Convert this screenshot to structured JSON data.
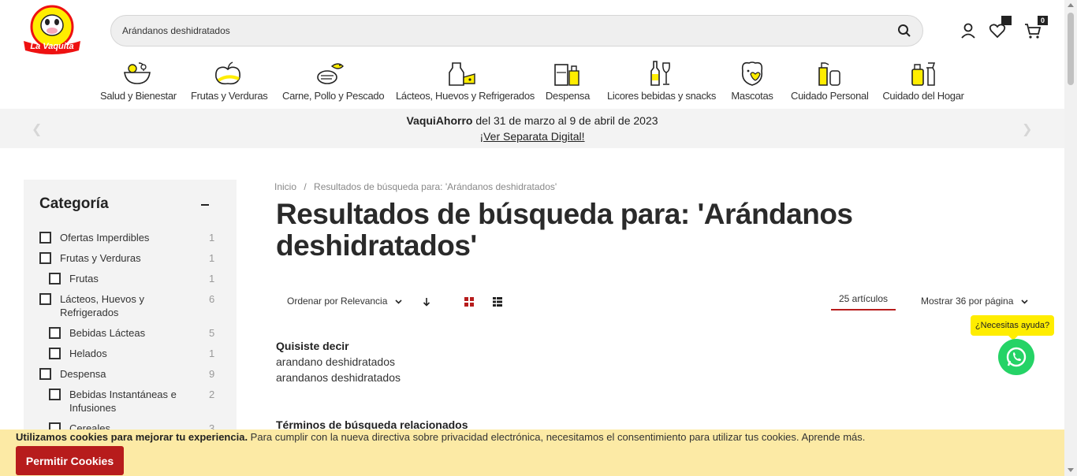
{
  "brand": {
    "logo_text": "La Vaquita"
  },
  "search": {
    "value": "Arándanos deshidratados",
    "placeholder": ""
  },
  "header": {
    "wishlist_badge": "",
    "cart_badge": "0"
  },
  "categories": [
    {
      "label": "Salud y Bienestar",
      "icon": "salad-bowl-icon"
    },
    {
      "label": "Frutas y Verduras",
      "icon": "fruits-icon"
    },
    {
      "label": "Carne, Pollo y Pescado",
      "icon": "meat-fish-icon"
    },
    {
      "label": "Lácteos, Huevos y Refrigerados",
      "icon": "dairy-icon"
    },
    {
      "label": "Despensa",
      "icon": "pantry-icon"
    },
    {
      "label": "Licores bebidas y snacks",
      "icon": "drinks-icon"
    },
    {
      "label": "Mascotas",
      "icon": "pet-icon"
    },
    {
      "label": "Cuidado Personal",
      "icon": "personal-care-icon"
    },
    {
      "label": "Cuidado del Hogar",
      "icon": "home-care-icon"
    }
  ],
  "promo": {
    "title_bold": "VaquiAhorro",
    "title_rest": " del 31 de marzo al 9 de abril de 2023",
    "link": "¡Ver Separata Digital!"
  },
  "sidebar": {
    "title": "Categoría",
    "facets": [
      {
        "label": "Ofertas Imperdibles",
        "count": "1",
        "indent": 0
      },
      {
        "label": "Frutas y Verduras",
        "count": "1",
        "indent": 0
      },
      {
        "label": "Frutas",
        "count": "1",
        "indent": 1
      },
      {
        "label": "Lácteos, Huevos y Refrigerados",
        "count": "6",
        "indent": 0
      },
      {
        "label": "Bebidas Lácteas",
        "count": "5",
        "indent": 1
      },
      {
        "label": "Helados",
        "count": "1",
        "indent": 1
      },
      {
        "label": "Despensa",
        "count": "9",
        "indent": 0
      },
      {
        "label": "Bebidas Instantáneas e Infusiones",
        "count": "2",
        "indent": 1
      },
      {
        "label": "Cereales",
        "count": "3",
        "indent": 1
      }
    ]
  },
  "breadcrumb": {
    "home": "Inicio",
    "separator": "/",
    "current": "Resultados de búsqueda para: 'Arándanos deshidratados'"
  },
  "page_title": "Resultados de búsqueda para: 'Arándanos deshidratados'",
  "toolbar": {
    "sort_label": "Ordenar por Relevancia",
    "count_label": "25 artículos",
    "perpage_label": "Mostrar 36 por página"
  },
  "did_you_mean": {
    "heading": "Quisiste decir",
    "suggestions": [
      "arandano deshidratados",
      "arandanos deshidratados"
    ]
  },
  "related": {
    "heading": "Términos de búsqueda relacionados"
  },
  "help": {
    "label": "¿Necesitas ayuda?"
  },
  "cookie": {
    "bold": "Utilizamos cookies para mejorar tu experiencia.",
    "text": " Para cumplir con la nueva directiva sobre privacidad electrónica, necesitamos el consentimiento para utilizar tus cookies.",
    "link": "Aprende más.",
    "button": "Permitir Cookies"
  },
  "colors": {
    "accent": "#b71c1c",
    "brand_yellow": "#ffed00",
    "whatsapp": "#25d366"
  }
}
